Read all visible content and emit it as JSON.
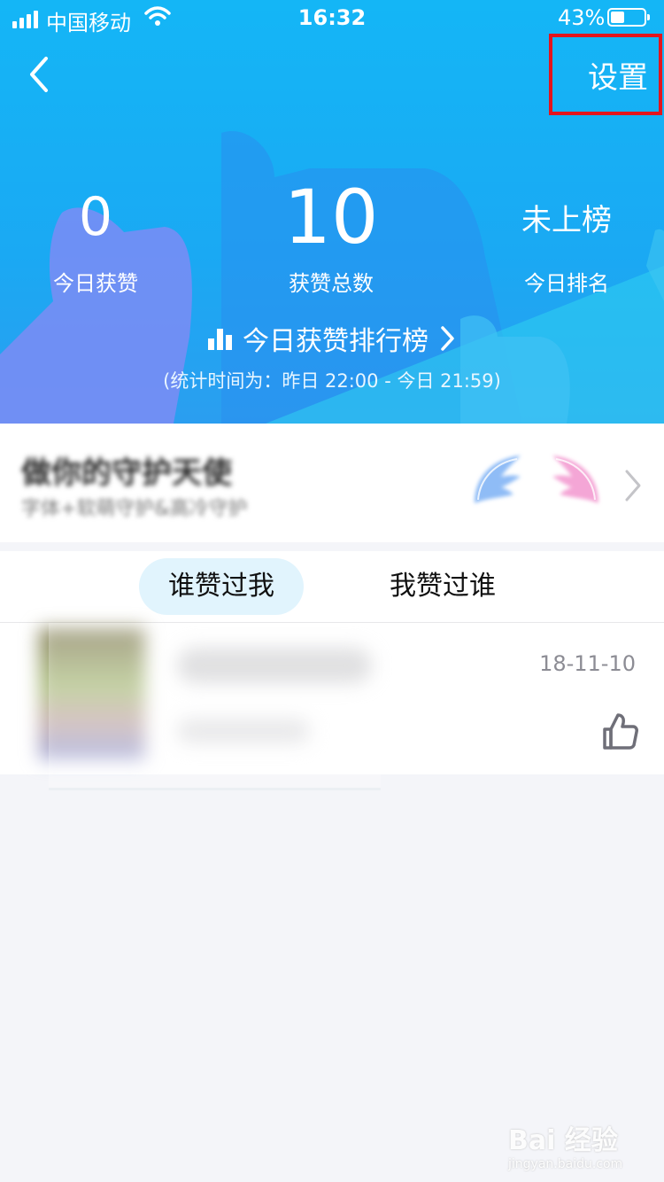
{
  "status_bar": {
    "carrier": "中国移动",
    "time": "16:32",
    "battery_percent": "43%",
    "battery_level": 0.43,
    "signal_bars": 4
  },
  "nav": {
    "back_icon": "chevron-left-icon",
    "settings_label": "设置"
  },
  "stats": [
    {
      "value": "0",
      "label": "今日获赞"
    },
    {
      "value": "10",
      "label": "获赞总数"
    },
    {
      "value": "未上榜",
      "label": "今日排名"
    }
  ],
  "ranking": {
    "icon": "bar-chart-icon",
    "label": "今日获赞排行榜",
    "note": "(统计时间为：昨日 22:00 - 今日 21:59)"
  },
  "banner": {
    "title": "做你的守护天使",
    "subtitle": "字体+软萌守护&高冷守护"
  },
  "tabs": [
    {
      "label": "谁赞过我",
      "active": true
    },
    {
      "label": "我赞过谁",
      "active": false
    }
  ],
  "list": [
    {
      "date": "18-11-10",
      "action_icon": "thumbs-up-icon"
    }
  ],
  "watermark": {
    "main": "Bai 经验",
    "sub": "jingyan.baidu.com"
  },
  "colors": {
    "header_blue": "#14b6f6",
    "highlight_red": "#e4141c",
    "tab_active_bg": "#e1f4fd",
    "page_bg": "#f4f5f9"
  }
}
